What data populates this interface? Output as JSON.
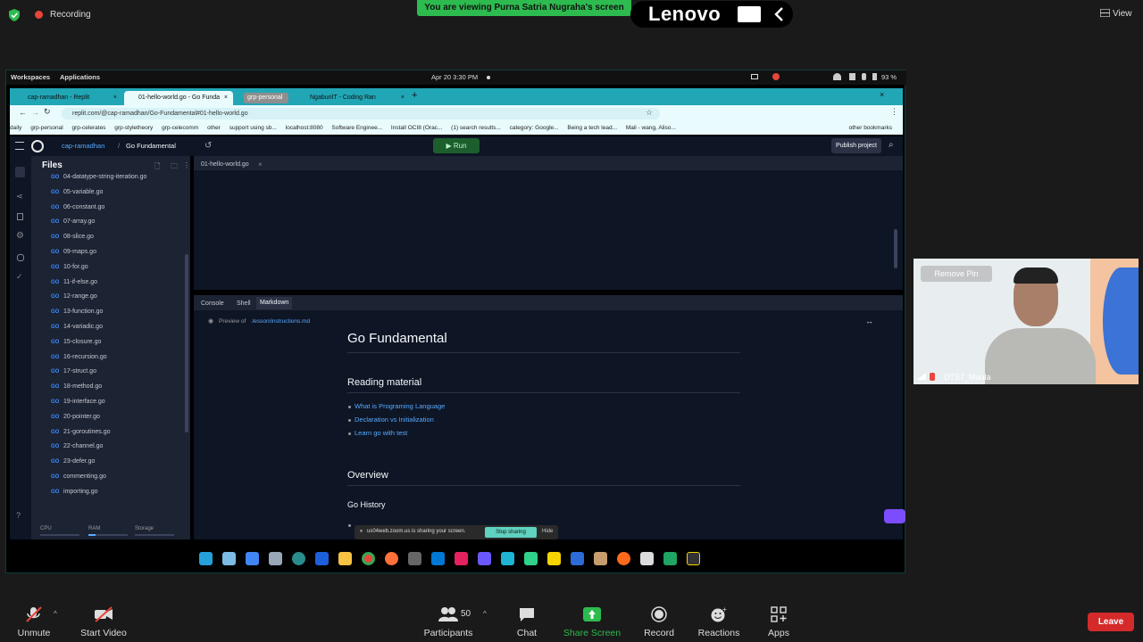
{
  "zoom": {
    "recording_label": "Recording",
    "viewing_banner": "You are viewing Purna Satria Nugraha's screen",
    "brand_logo_text": "Lenovo",
    "view_label": "View",
    "bottom": {
      "unmute": "Unmute",
      "start_video": "Start Video",
      "participants": "Participants",
      "participant_count": "50",
      "chat": "Chat",
      "share_screen": "Share Screen",
      "record": "Record",
      "reactions": "Reactions",
      "apps": "Apps",
      "leave": "Leave"
    },
    "participant_video": {
      "name": "DTS7_Maula",
      "overlay_button": "Remove Pin"
    },
    "colors": {
      "accent_green": "#2dbb4f",
      "leave_red": "#d52a2a"
    }
  },
  "desktop": {
    "workspaces": "Workspaces",
    "applications": "Applications",
    "clock": "Apr 20  3:30 PM",
    "battery": "93 %"
  },
  "browser": {
    "tabs": [
      {
        "label": "cap-ramadhan - Replit"
      },
      {
        "label": "01-hello-world.go - Go Funda"
      },
      {
        "label": "grp-personal"
      },
      {
        "label": "NgaburiIT - Coding Ran"
      }
    ],
    "url": "replit.com/@cap-ramadhan/Go-Fundamental#01-hello-world.go",
    "bookmarks": [
      "daily",
      "grp-personal",
      "grp-celerates",
      "grp-styletheory",
      "grp-celecomm",
      "other",
      "support using sb...",
      "localhost:8080",
      "Software Enginee...",
      "Install OCI8 (Orac...",
      "(1) search results...",
      "category: Google...",
      "Being a tech lead...",
      "Mail - wang, Aliso..."
    ],
    "other_bookmarks": "other bookmarks"
  },
  "replit": {
    "user": "cap-ramadhan",
    "separator": "/",
    "project": "Go Fundamental",
    "run_label": "Run",
    "publish_label": "Publish project",
    "files_title": "Files",
    "files": [
      "04-datatype-string-iteration.go",
      "05-variable.go",
      "06-constant.go",
      "07-array.go",
      "08-slice.go",
      "09-maps.go",
      "10-for.go",
      "11-if-else.go",
      "12-range.go",
      "13-function.go",
      "14-variadic.go",
      "15-closure.go",
      "16-recursion.go",
      "17-struct.go",
      "18-method.go",
      "19-interface.go",
      "20-pointer.go",
      "21-goroutines.go",
      "22-channel.go",
      "23-defer.go",
      "commenting.go",
      "importing.go"
    ],
    "go_badge": "GO",
    "editor_tab": "01-hello-world.go",
    "console_tabs": [
      "Console",
      "Shell",
      "Markdown"
    ],
    "preview_prefix": "Preview of",
    "preview_path": ".lesson/instructions.md",
    "resources": [
      "CPU",
      "RAM",
      "Storage"
    ],
    "markdown": {
      "h1": "Go Fundamental",
      "h2_reading": "Reading material",
      "links": [
        "What is Programing Language",
        "Declaration vs Initialization",
        "Learn go with test"
      ],
      "h2_overview": "Overview",
      "h3_history": "Go History"
    },
    "colors": {
      "bg": "#1c2333",
      "header": "#0e1525",
      "link": "#57abff",
      "run_green": "#1d5e2d"
    }
  },
  "zoom_share_notice": {
    "text": "us04web.zoom.us is sharing your screen.",
    "stop_label": "Stop sharing",
    "hide_label": "Hide"
  }
}
